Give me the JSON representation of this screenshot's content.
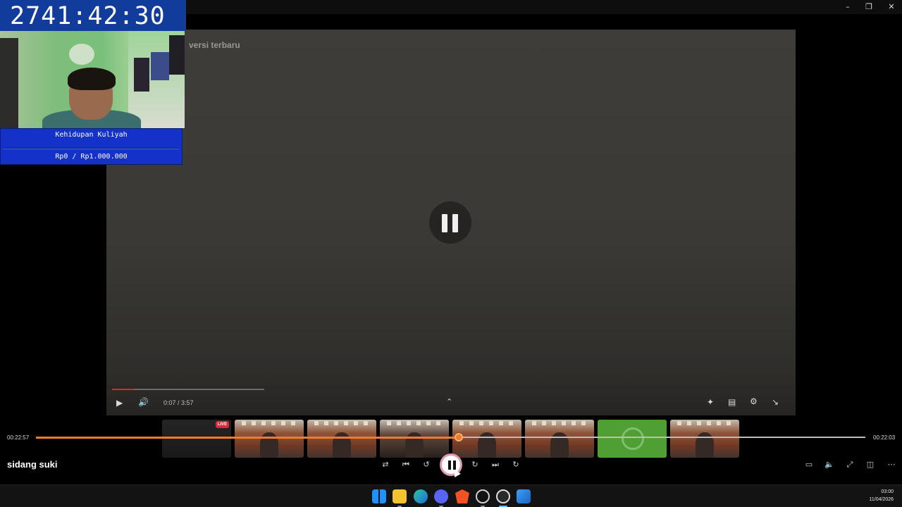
{
  "overlay": {
    "timer": "2741:42:30",
    "goal_title": "Kehidupan Kuliyah",
    "goal_amount": "Rp0 / Rp1.000.000"
  },
  "window": {
    "controls": [
      "minimize-icon",
      "restore-icon",
      "close-icon"
    ]
  },
  "video": {
    "caption": "versi terbaru",
    "state": "paused",
    "time": "0:07 / 3:57",
    "progress_fraction": 0.03
  },
  "thumbnails": {
    "live_label": "LIVE",
    "count": 8
  },
  "player": {
    "elapsed": "00:22:57",
    "remaining": "00:22:03",
    "progress_fraction": 0.51,
    "title": "sidang suki",
    "accent": "#ef7b2c"
  },
  "taskbar": {
    "time": "03:00",
    "date": "11/04/2026"
  }
}
